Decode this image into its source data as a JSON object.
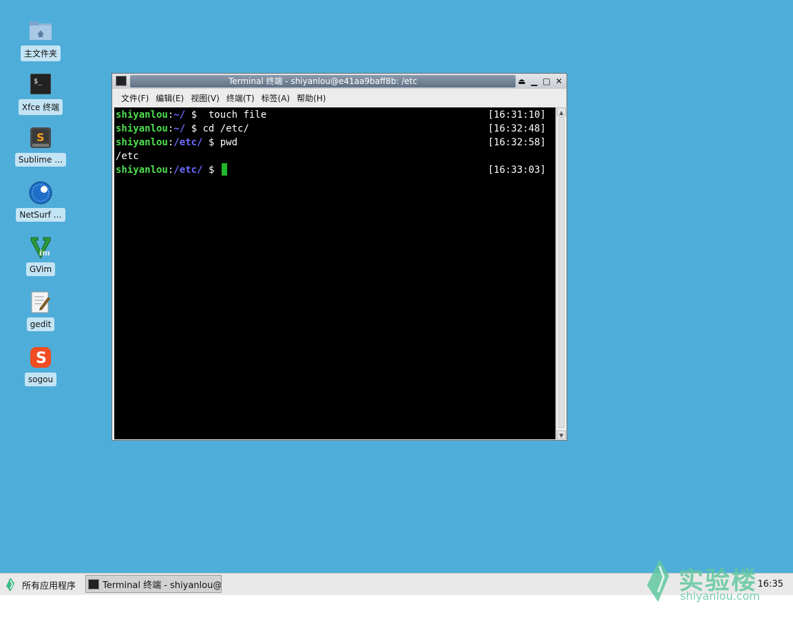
{
  "desktop": {
    "icons": [
      {
        "label": "主文件夹",
        "icon": "home-folder-icon"
      },
      {
        "label": "Xfce 终端",
        "icon": "terminal-icon"
      },
      {
        "label": "Sublime …",
        "icon": "sublime-icon"
      },
      {
        "label": "NetSurf …",
        "icon": "netsurf-icon"
      },
      {
        "label": "GVim",
        "icon": "gvim-icon"
      },
      {
        "label": "gedit",
        "icon": "gedit-icon"
      },
      {
        "label": "sogou",
        "icon": "sogou-icon"
      }
    ]
  },
  "window": {
    "title": "Terminal 终端 - shiyanlou@e41aa9baff8b: /etc",
    "menu": [
      "文件(F)",
      "编辑(E)",
      "视图(V)",
      "终端(T)",
      "标签(A)",
      "帮助(H)"
    ],
    "buttons": {
      "shade": "⏏",
      "minimize": "▁",
      "maximize": "□",
      "close": "✕"
    }
  },
  "terminal": {
    "lines": [
      {
        "user": "shiyanlou",
        "sep": ":",
        "path": "~/",
        "prompt": " $ ",
        "cmd": " touch file",
        "time": "[16:31:10]"
      },
      {
        "user": "shiyanlou",
        "sep": ":",
        "path": "~/",
        "prompt": " $ ",
        "cmd": "cd /etc/",
        "time": "[16:32:48]"
      },
      {
        "user": "shiyanlou",
        "sep": ":",
        "path": "/etc/",
        "prompt": " $ ",
        "cmd": "pwd",
        "time": "[16:32:58]"
      },
      {
        "output": "/etc"
      },
      {
        "user": "shiyanlou",
        "sep": ":",
        "path": "/etc/",
        "prompt": " $ ",
        "cmd": "",
        "time": "[16:33:03]"
      }
    ]
  },
  "taskbar": {
    "apps_label": "所有应用程序",
    "task_label": "Terminal 终端 - shiyanlou@…",
    "clock": "16:35",
    "watermark_brand": "实验楼",
    "watermark_sub": "shiyanlou.com"
  },
  "colors": {
    "desktop": "#4fadd9",
    "user": "#4ee04e",
    "path": "#6b6bff",
    "cursor": "#23b52a"
  }
}
